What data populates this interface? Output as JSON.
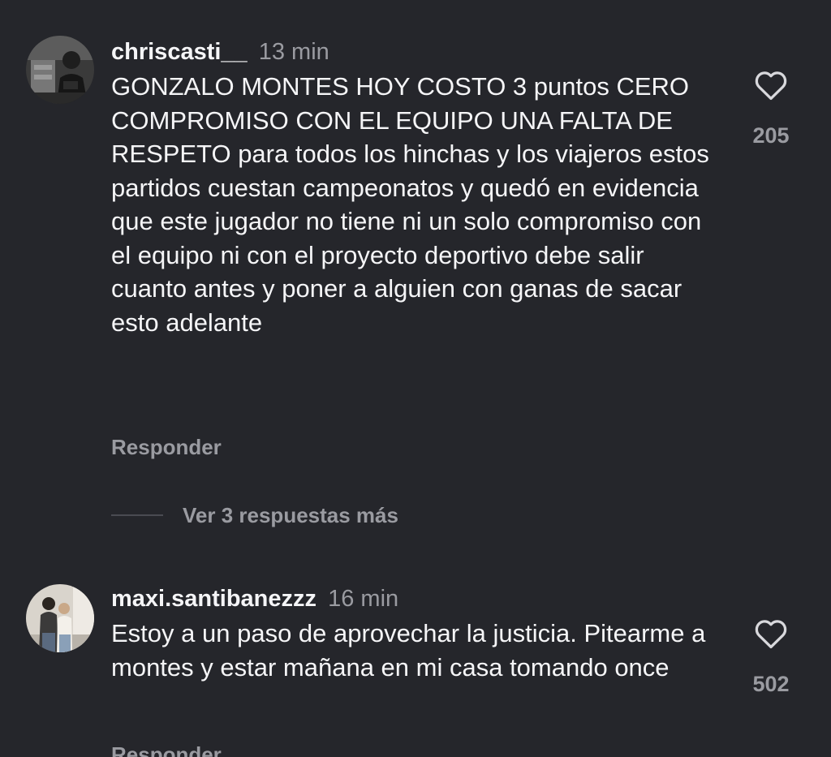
{
  "comments": [
    {
      "username": "chriscasti__",
      "time": "13 min",
      "text": "GONZALO MONTES HOY COSTO 3 puntos CERO COMPROMISO CON EL EQUIPO UNA FALTA DE RESPETO para todos los hinchas y los viajeros estos partidos cuestan campeonatos y quedó en evidencia que este jugador no tiene ni un solo compromiso con el equipo ni con el proyecto deportivo debe salir cuanto antes y poner a alguien con ganas de sacar esto adelante",
      "reply_label": "Responder",
      "likes": "205",
      "view_replies_label": "Ver 3 respuestas más"
    },
    {
      "username": "maxi.santibanezzz",
      "time": "16 min",
      "text": "Estoy a un paso de aprovechar la justicia. Pitearme a montes y estar mañana en mi casa tomando once",
      "reply_label": "Responder",
      "likes": "502"
    }
  ],
  "icons": {
    "like": "heart-outline-icon"
  },
  "colors": {
    "background": "#25262b",
    "primary_text": "#f5f5f7",
    "secondary_text": "#9a9ba1"
  }
}
